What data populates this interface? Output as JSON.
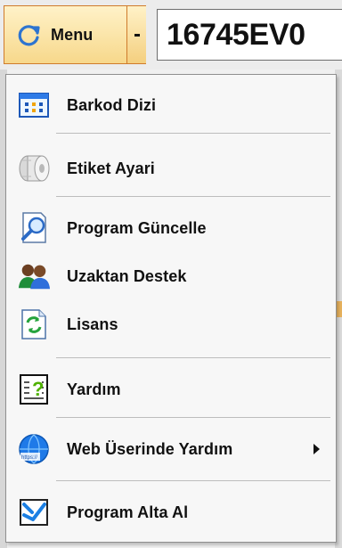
{
  "toolbar": {
    "menu_label": "Menu",
    "code_value": "16745EV0"
  },
  "menu": {
    "items": [
      {
        "label": "Barkod Dizi",
        "icon": "barcode-grid-icon"
      },
      {
        "label": "Etiket Ayari",
        "icon": "label-roll-icon"
      },
      {
        "label": "Program Güncelle",
        "icon": "update-magnifier-icon"
      },
      {
        "label": "Uzaktan Destek",
        "icon": "remote-support-users-icon"
      },
      {
        "label": "Lisans",
        "icon": "license-refresh-icon"
      },
      {
        "label": "Yardım",
        "icon": "help-question-icon"
      },
      {
        "label": "Web Üserinde Yardım",
        "icon": "web-help-globe-icon",
        "has_submenu": true
      },
      {
        "label": "Program Alta Al",
        "icon": "minimize-window-icon"
      }
    ]
  },
  "colors": {
    "menu_border": "#cf7b2c",
    "menu_fill_top": "#fff2c8",
    "menu_fill_bottom": "#f7d88b",
    "dropdown_bg": "#f7f7f7"
  }
}
